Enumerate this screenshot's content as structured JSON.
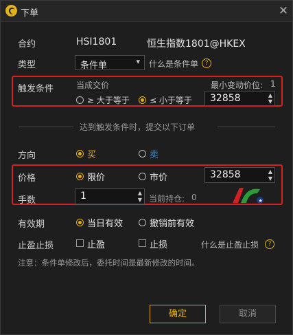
{
  "window": {
    "title": "下单",
    "close_icon": "close-icon"
  },
  "contract": {
    "label": "合约",
    "code": "HSI1801",
    "name": "恒生指数1801@HKEX"
  },
  "type": {
    "label": "类型",
    "value": "条件单",
    "help": "什么是条件单"
  },
  "trigger": {
    "label": "触发条件",
    "price_type": "当成交价",
    "min_tick_label": "最小变动价位:",
    "min_tick_value": "1",
    "opt_ge": "≥ 大于等于",
    "opt_le": "≤ 小于等于",
    "selected": "le",
    "price": "32858"
  },
  "divider_text": "达到触发条件时，提交以下订单",
  "direction": {
    "label": "方向",
    "buy": "买",
    "sell": "卖",
    "selected": "buy"
  },
  "price": {
    "label": "价格",
    "limit": "限价",
    "market": "市价",
    "selected": "limit",
    "value": "32858"
  },
  "qty": {
    "label": "手数",
    "value": "1",
    "position_label": "当前持仓:",
    "position_value": "0"
  },
  "validity": {
    "label": "有效期",
    "day": "当日有效",
    "gtc": "撤销前有效",
    "selected": "day"
  },
  "stop": {
    "label": "止盈止损",
    "take_profit": "止盈",
    "stop_loss": "止损",
    "help": "什么是止盈止损"
  },
  "note": "注意：条件单修改后，委托时间是最新修改的时间。",
  "buttons": {
    "ok": "确定",
    "cancel": "取消"
  },
  "colors": {
    "accent": "#e6b012",
    "highlight_box": "#d82020",
    "sell": "#3a8fd8"
  }
}
